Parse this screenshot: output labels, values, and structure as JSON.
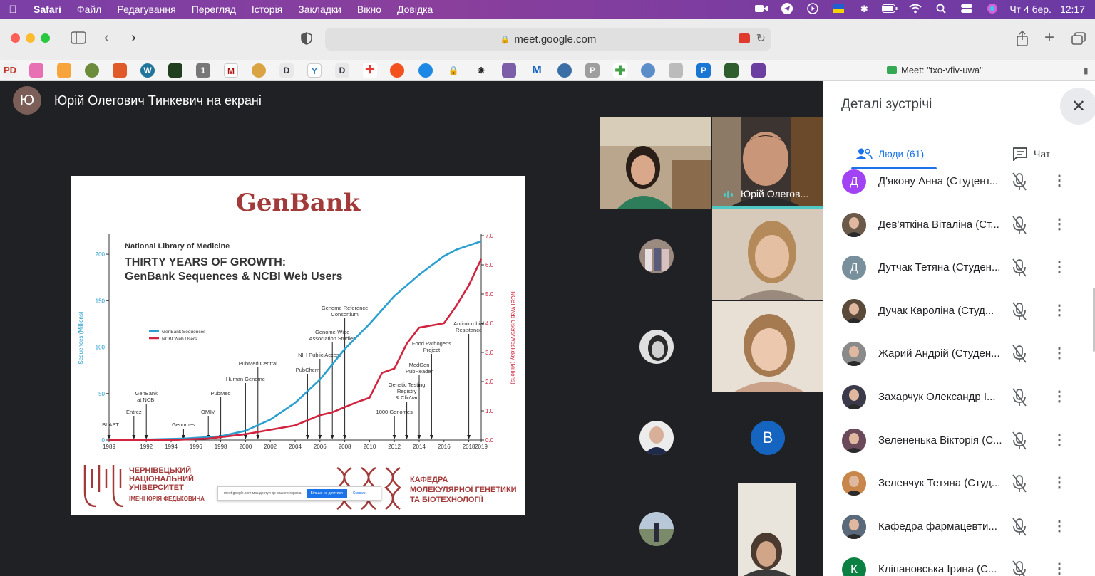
{
  "menubar": {
    "app": "Safari",
    "items": [
      "Файл",
      "Редагування",
      "Перегляд",
      "Історія",
      "Закладки",
      "Вікно",
      "Довідка"
    ],
    "date": "Чт 4 бер.",
    "time": "12:17"
  },
  "browser": {
    "url": "meet.google.com",
    "tab_title": "Meet: \"txo-vfiv-uwa\""
  },
  "presenter": {
    "initial": "Ю",
    "text": "Юрій Олегович Тинкевич на екрані"
  },
  "slide": {
    "title": "GenBank",
    "org": "National Library of Medicine",
    "headline_1": "THIRTY YEARS OF GROWTH:",
    "headline_2": "GenBank Sequences & NCBI Web Users",
    "university": [
      "ЧЕРНІВЕЦЬКИЙ",
      "НАЦІОНАЛЬНИЙ",
      "УНІВЕРСИТЕТ"
    ],
    "university_sub": "ІМЕНІ ЮРІЯ ФЕДЬКОВИЧА",
    "department": [
      "КАФЕДРА",
      "МОЛЕКУЛЯРНОЇ ГЕНЕТИКИ",
      "ТА БІОТЕХНОЛОГІЇ"
    ],
    "share_bar": {
      "text": "meet.google.com має доступ до вашого екрана.",
      "stop": "Більше не ділитися",
      "hide": "Сховати"
    }
  },
  "chart_data": {
    "type": "line",
    "title": "",
    "xlabel": "",
    "ylabel": "Sequences (Millions)",
    "y2label": "NCBI Web Users/Weekday (Millions)",
    "x_ticks": [
      "1989",
      "1992",
      "1994",
      "1996",
      "1998",
      "2000",
      "2002",
      "2004",
      "2006",
      "2008",
      "2010",
      "2012",
      "2014",
      "2016",
      "2018",
      "2019"
    ],
    "ylim": [
      0,
      220
    ],
    "y_ticks": [
      "0",
      "50",
      "100",
      "150",
      "200"
    ],
    "y2lim": [
      0,
      7.0
    ],
    "y2_ticks": [
      "0.0",
      "1.0",
      "2.0",
      "3.0",
      "4.0",
      "5.0",
      "6.0",
      "7.0"
    ],
    "series": [
      {
        "name": "GenBank Sequences",
        "color": "#2a9fd0",
        "axis": "left",
        "x": [
          1989,
          1992,
          1995,
          1998,
          2000,
          2002,
          2004,
          2006,
          2008,
          2010,
          2012,
          2014,
          2016,
          2017,
          2019
        ],
        "y": [
          0,
          0.5,
          1.5,
          4,
          10,
          22,
          40,
          65,
          98,
          125,
          155,
          178,
          198,
          205,
          214
        ]
      },
      {
        "name": "NCBI Web Users",
        "color": "#d0243f",
        "axis": "right",
        "x": [
          1989,
          1994,
          1997,
          2000,
          2002,
          2004,
          2006,
          2007,
          2009,
          2010,
          2011,
          2012,
          2013,
          2014,
          2016,
          2017,
          2018,
          2019
        ],
        "y": [
          0,
          0,
          0.05,
          0.2,
          0.35,
          0.5,
          0.85,
          0.95,
          1.3,
          1.45,
          2.3,
          2.45,
          3.3,
          3.85,
          4.0,
          4.6,
          5.3,
          6.2
        ]
      }
    ],
    "annotations": [
      {
        "text": "BLAST",
        "x": 1989
      },
      {
        "text": "Entrez",
        "x": 1991
      },
      {
        "text": "GenBank\nat NCBI",
        "x": 1992
      },
      {
        "text": "Genomes",
        "x": 1995
      },
      {
        "text": "OMIM",
        "x": 1997
      },
      {
        "text": "PubMed",
        "x": 1998
      },
      {
        "text": "Human Genome",
        "x": 2000
      },
      {
        "text": "PubMed Central",
        "x": 2001
      },
      {
        "text": "PubChem",
        "x": 2005
      },
      {
        "text": "NIH Public Access",
        "x": 2006
      },
      {
        "text": "Genome-Wide\nAssociation Studies",
        "x": 2007
      },
      {
        "text": "Genome Reference\nConsortium",
        "x": 2008
      },
      {
        "text": "1000 Genomes",
        "x": 2012
      },
      {
        "text": "Genetic Testing\nRegistry\n& ClinVar",
        "x": 2013
      },
      {
        "text": "MedGen\nPubReader",
        "x": 2014
      },
      {
        "text": "Food Pathogens\nProject",
        "x": 2015
      },
      {
        "text": "Antimicrobial\nResistance",
        "x": 2018
      }
    ]
  },
  "tiles": {
    "speaker_name": "Юрій Олегов..."
  },
  "panel": {
    "title": "Деталі зустрічі",
    "tab_people": "Люди (61)",
    "tab_chat": "Чат",
    "participants": [
      {
        "name": "Д'якону Анна (Студент...",
        "initial": "Д",
        "color": "#a142f4"
      },
      {
        "name": "Дев'яткіна Віталіна (Ст...",
        "initial": "",
        "color": "#6b5a4a"
      },
      {
        "name": "Дутчак Тетяна (Студен...",
        "initial": "Д",
        "color": "#78909c"
      },
      {
        "name": "Дучак Кароліна (Студ...",
        "initial": "",
        "color": "#5a4a3a"
      },
      {
        "name": "Жарий Андрій (Студен...",
        "initial": "",
        "color": "#8a8a8a"
      },
      {
        "name": "Захарчук Олександр І...",
        "initial": "",
        "color": "#3a3a4a"
      },
      {
        "name": "Зелененька Вікторія (С...",
        "initial": "",
        "color": "#6a4a5a"
      },
      {
        "name": "Зеленчук Тетяна (Студ...",
        "initial": "",
        "color": "#c8864a"
      },
      {
        "name": "Кафедра фармацевти...",
        "initial": "",
        "color": "#5a6a7a"
      },
      {
        "name": "Кліпановська Ірина (С...",
        "initial": "К",
        "color": "#0b8043"
      }
    ]
  }
}
